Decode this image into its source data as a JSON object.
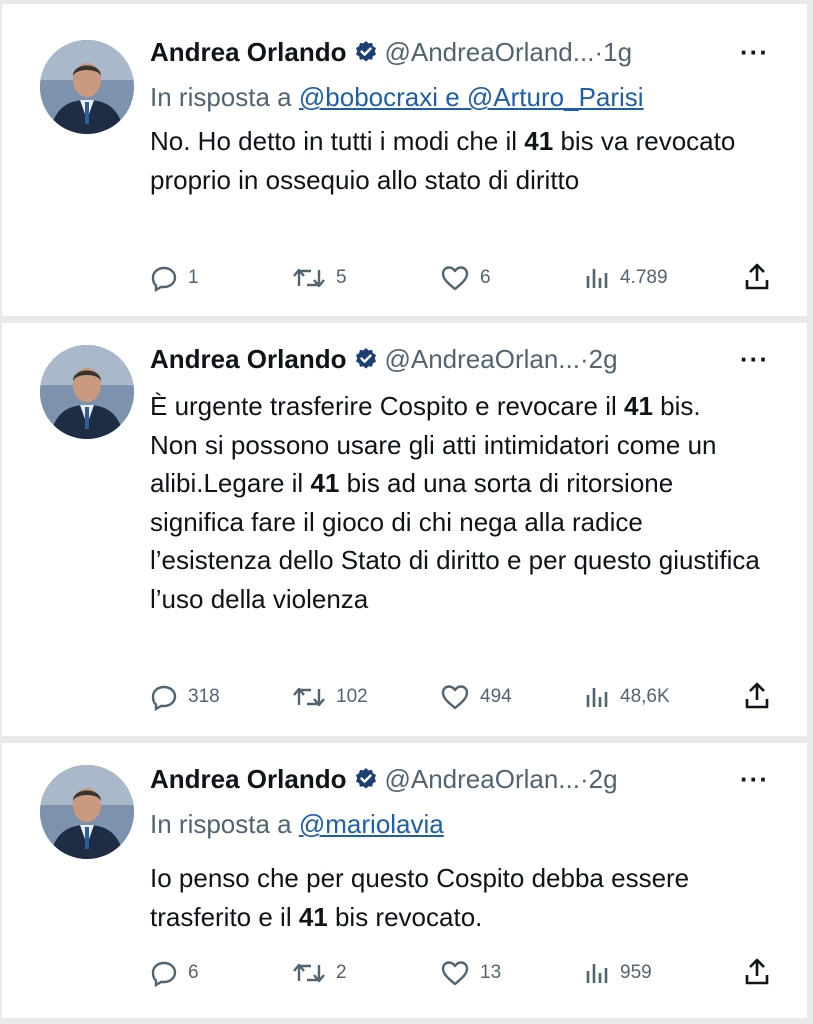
{
  "tweets": [
    {
      "author": "Andrea Orlando",
      "handle": "@AndreaOrland...",
      "separator": "·",
      "time": "1g",
      "more": "···",
      "reply_prefix": "In risposta a",
      "reply_to": "@bobocraxi e @Arturo_Parisi",
      "text": {
        "p1_a": "No. Ho detto in tutti i modi che il ",
        "p1_b": "41",
        "p1_c": " bis va revocato proprio in ossequio allo stato di diritto"
      },
      "stats": {
        "replies": "1",
        "retweets": "5",
        "likes": "6",
        "views": "4.789"
      }
    },
    {
      "author": "Andrea Orlando",
      "handle": "@AndreaOrlan...",
      "separator": "·",
      "time": "2g",
      "more": "···",
      "text": {
        "p1_a": "È urgente trasferire Cospito e revocare il ",
        "p1_b": "41",
        "p1_c": " bis.",
        "p2_a": "Non si possono usare gli atti intimidatori come un alibi.Legare il ",
        "p2_b": "41",
        "p2_c": " bis ad una sorta di ritorsione significa fare il gioco di chi nega alla radice l’esistenza dello Stato di diritto e per questo giustifica l’uso della violenza"
      },
      "stats": {
        "replies": "318",
        "retweets": "102",
        "likes": "494",
        "views": "48,6K"
      }
    },
    {
      "author": "Andrea Orlando",
      "handle": "@AndreaOrlan...",
      "separator": "·",
      "time": "2g",
      "more": "···",
      "reply_prefix": "In risposta a",
      "reply_to": "@mariolavia",
      "text": {
        "p1_a": "Io penso che per questo Cospito debba essere trasferito e il ",
        "p1_b": "41",
        "p1_c": " bis revocato."
      },
      "stats": {
        "replies": "6",
        "retweets": "2",
        "likes": "13",
        "views": "959"
      }
    }
  ],
  "icons": {
    "verified": "verified-badge-icon",
    "reply": "reply-icon",
    "retweet": "retweet-icon",
    "like": "heart-icon",
    "views": "views-bar-chart-icon",
    "share": "share-icon"
  },
  "colors": {
    "text": "#0f1419",
    "secondary": "#536471",
    "link": "#1d5fa8",
    "verified": "#1d3f72",
    "background": "#e9e9e9",
    "card": "#ffffff"
  }
}
